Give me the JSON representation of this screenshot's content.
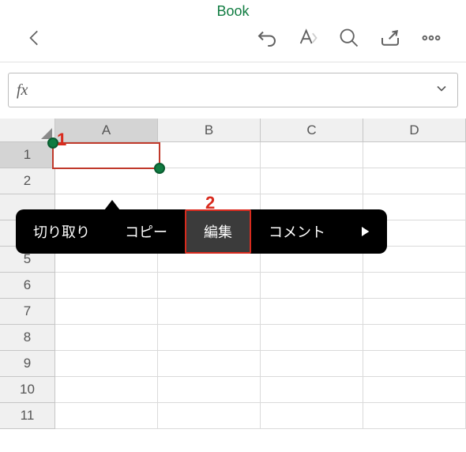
{
  "title": "Book",
  "formula": {
    "label": "fx",
    "value": ""
  },
  "columns": [
    "A",
    "B",
    "C",
    "D"
  ],
  "rows": [
    "1",
    "2",
    "",
    "",
    "5",
    "6",
    "7",
    "8",
    "9",
    "10",
    "11"
  ],
  "selected_col_index": 0,
  "selected_row_index": 0,
  "context_menu": {
    "items": [
      "切り取り",
      "コピー",
      "編集",
      "コメント"
    ],
    "highlight_index": 2
  },
  "annotations": {
    "one": "1",
    "two": "2"
  },
  "icons": {
    "back": "back-icon",
    "undo": "undo-icon",
    "font": "font-icon",
    "search": "search-icon",
    "share": "share-icon",
    "more": "more-icon",
    "chevron": "chevron-down-icon",
    "play": "play-icon"
  }
}
